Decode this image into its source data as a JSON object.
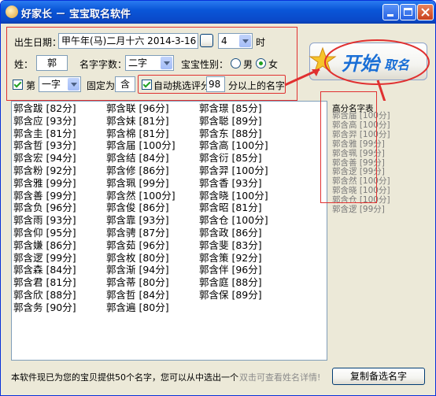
{
  "window": {
    "title": "好家长 － 宝宝取名软件"
  },
  "form": {
    "birth_label": "出生日期：",
    "birth_value": "甲午年(马)二月十六 2014-3-16",
    "hour_value": "4",
    "hour_unit": "时",
    "surname_label": "姓：",
    "surname_value": "郭",
    "name_length_label": "名字字数：",
    "name_length_value": "二字",
    "gender_label": "宝宝性别：",
    "gender_male": "男",
    "gender_female": "女",
    "fixed_prefix": "第",
    "fixed_pos_value": "一字",
    "fixed_label": "固定为",
    "fixed_char_value": "含",
    "auto_label": "自动挑选评分",
    "score_value": "98",
    "auto_suffix": "分以上的名字"
  },
  "start_button": {
    "label_main": "开始",
    "label_sub": "取名"
  },
  "names_columns": [
    [
      "郭含跋 [82分]",
      "郭含应 [93分]",
      "郭含圭 [81分]",
      "郭含哲 [93分]",
      "郭含宏 [94分]",
      "郭含粉 [92分]",
      "郭含雅 [99分]",
      "郭含善 [99分]",
      "郭含负 [96分]",
      "郭含雨 [93分]",
      "郭含仰 [95分]",
      "郭含嫌 [86分]",
      "郭含逻 [99分]",
      "郭含森 [84分]",
      "郭含君 [81分]",
      "郭含欣 [88分]",
      "郭含务 [90分]"
    ],
    [
      "郭含联 [96分]",
      "郭含妹 [81分]",
      "郭含棉 [81分]",
      "郭含届 [100分]",
      "郭含结 [84分]",
      "郭含修 [86分]",
      "郭含珮 [99分]",
      "郭含然 [100分]",
      "郭含俊 [86分]",
      "郭含靠 [93分]",
      "郭含骋 [87分]",
      "郭含茹 [96分]",
      "郭含枚 [80分]",
      "郭含渐 [94分]",
      "郭含蒂 [80分]",
      "郭含哲 [84分]",
      "郭含遍 [80分]"
    ],
    [
      "郭含璟 [85分]",
      "郭含聪 [89分]",
      "郭含东 [88分]",
      "郭含高 [100分]",
      "郭含衍 [85分]",
      "郭含羿 [100分]",
      "郭含香 [93分]",
      "郭含晓 [100分]",
      "郭含昭 [81分]",
      "郭含仓 [100分]",
      "郭含政 [86分]",
      "郭含斐 [83分]",
      "郭含策 [92分]",
      "郭含伴 [96分]",
      "郭含庭 [88分]",
      "郭含保 [89分]"
    ]
  ],
  "high_score": {
    "title": "高分名字表",
    "items": [
      "郭含届 [100分]",
      "郭含高 [100分]",
      "郭含羿 [100分]",
      "郭含雅 [99分]",
      "郭含珮 [99分]",
      "郭含善 [99分]",
      "郭含逻 [99分]",
      "郭含然 [100分]",
      "郭含晓 [100分]",
      "郭含仓 [100分]",
      "郭含逻 [99分]"
    ]
  },
  "status": {
    "message": "本软件现已为您的宝贝提供50个名字，您可以从中选出一个",
    "hint": "双击可查看姓名详情!"
  },
  "copy_button": {
    "label": "复制备选名字"
  },
  "colors": {
    "titlebar": "#0a56d8",
    "annotation_red": "#e03030",
    "start_text": "#1a6fd6"
  }
}
